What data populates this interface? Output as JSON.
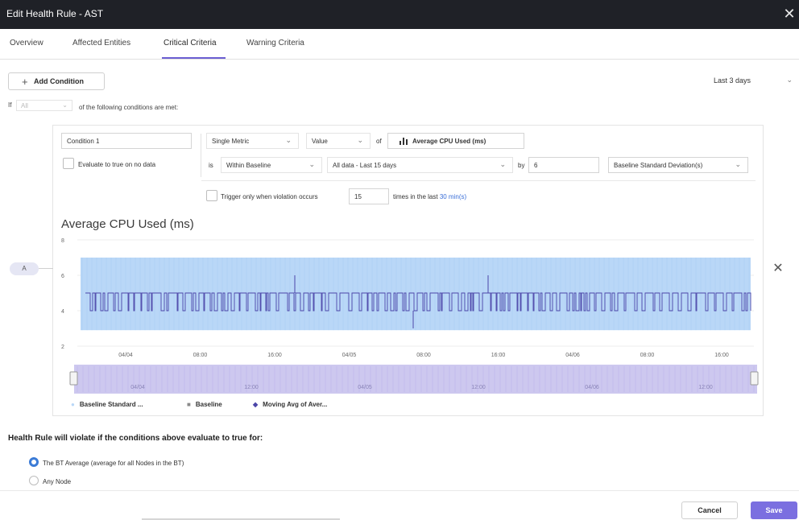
{
  "window": {
    "title": "Edit Health Rule - AST",
    "close_glyph": "✕"
  },
  "tabs": [
    {
      "label": "Overview"
    },
    {
      "label": "Affected Entities"
    },
    {
      "label": "Critical Criteria",
      "active": true
    },
    {
      "label": "Warning Criteria"
    }
  ],
  "toolbar": {
    "add_condition_label": "Add Condition",
    "time_range": "Last 3 days"
  },
  "logic": {
    "if_label": "If",
    "match_value": "All",
    "conditions_text": "of the following conditions are met:"
  },
  "condition": {
    "name": "Condition 1",
    "evaluate_no_data_label": "Evaluate to true on no data",
    "metric_type": "Single Metric",
    "value_type": "Value",
    "of_label": "of",
    "metric_name": "Average CPU Used (ms)",
    "is_label": "is",
    "operator": "Within Baseline",
    "baseline": "All data - Last 15 days",
    "by_label": "by",
    "by_value": "6",
    "deviation_unit": "Baseline Standard Deviation(s)",
    "trigger_label": "Trigger only when violation occurs",
    "trigger_count": "15",
    "times_label": "times in the last",
    "times_link": "30 min(s)",
    "tag": "A",
    "remove_glyph": "✕"
  },
  "chart_data": {
    "type": "line",
    "title": "Average CPU Used (ms)",
    "ylim": [
      2,
      8
    ],
    "y_ticks": [
      "8",
      "6",
      "4",
      "2"
    ],
    "x_ticks": [
      "04/04",
      "08:00",
      "16:00",
      "04/05",
      "08:00",
      "16:00",
      "04/06",
      "08:00",
      "16:00"
    ],
    "navigator_ticks": [
      "04/04",
      "12:00",
      "04/05",
      "12:00",
      "04/06",
      "12:00"
    ],
    "band": {
      "name": "Baseline Standard ...",
      "lower": 2.9,
      "upper": 7.0,
      "color": "#b9d7f7"
    },
    "series": [
      {
        "name": "Baseline",
        "color": "#8a8a8a"
      },
      {
        "name": "Moving Avg of Aver...",
        "color": "#4b45a8",
        "low": 4.0,
        "high": 5.0,
        "spike_max": 6.0,
        "spike_min": 3.0
      }
    ],
    "grid": true,
    "legend_position": "bottom-left"
  },
  "violation": {
    "title": "Health Rule will violate if the conditions above evaluate to true for:",
    "options": [
      {
        "label": "The BT Average (average for all Nodes in the BT)",
        "selected": true
      },
      {
        "label": "Any Node",
        "selected": false
      }
    ]
  },
  "footer": {
    "cancel_label": "Cancel",
    "save_label": "Save"
  },
  "colors": {
    "accent": "#7b6fe0",
    "tab_underline": "#6b5ed2",
    "link": "#3a6fd8",
    "titlebar": "#1f2127"
  }
}
